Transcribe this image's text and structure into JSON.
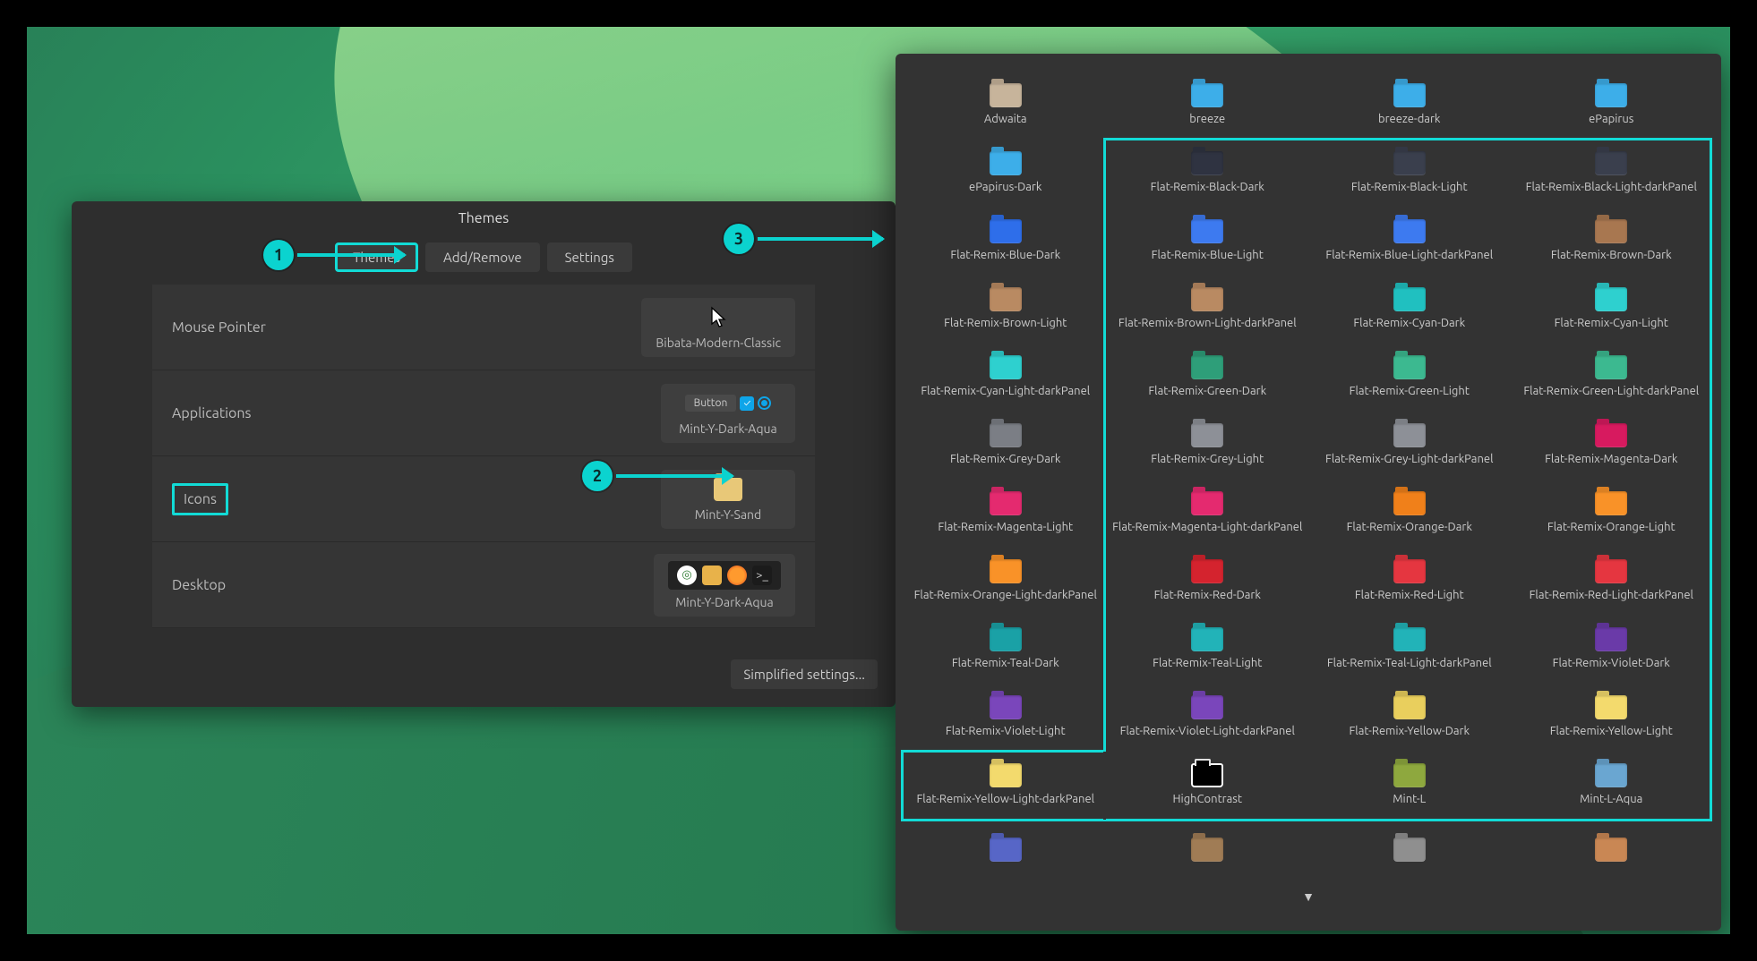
{
  "annotations": {
    "m1": "1",
    "m2": "2",
    "m3": "3"
  },
  "themes": {
    "title": "Themes",
    "tabs": {
      "themes": "Themes",
      "addremove": "Add/Remove",
      "settings": "Settings"
    },
    "rows": {
      "mouse": {
        "label": "Mouse Pointer",
        "value": "Bibata-Modern-Classic"
      },
      "apps": {
        "label": "Applications",
        "value": "Mint-Y-Dark-Aqua",
        "btn": "Button"
      },
      "icons": {
        "label": "Icons",
        "value": "Mint-Y-Sand"
      },
      "desktop": {
        "label": "Desktop",
        "value": "Mint-Y-Dark-Aqua"
      }
    },
    "simplified": "Simplified settings..."
  },
  "picker": {
    "items": [
      {
        "name": "Adwaita",
        "color": "#c7b49b"
      },
      {
        "name": "breeze",
        "color": "#3daee9"
      },
      {
        "name": "breeze-dark",
        "color": "#3daee9"
      },
      {
        "name": "ePapirus",
        "color": "#3daee9"
      },
      {
        "name": "ePapirus-Dark",
        "color": "#3daee9"
      },
      {
        "name": "Flat-Remix-Black-Dark",
        "color": "#2f3341"
      },
      {
        "name": "Flat-Remix-Black-Light",
        "color": "#3a3f4d"
      },
      {
        "name": "Flat-Remix-Black-Light-darkPanel",
        "color": "#3a3f4d"
      },
      {
        "name": "Flat-Remix-Blue-Dark",
        "color": "#2e6eea"
      },
      {
        "name": "Flat-Remix-Blue-Light",
        "color": "#3d7af0"
      },
      {
        "name": "Flat-Remix-Blue-Light-darkPanel",
        "color": "#3d7af0"
      },
      {
        "name": "Flat-Remix-Brown-Dark",
        "color": "#a87750"
      },
      {
        "name": "Flat-Remix-Brown-Light",
        "color": "#b98a62"
      },
      {
        "name": "Flat-Remix-Brown-Light-darkPanel",
        "color": "#b98a62"
      },
      {
        "name": "Flat-Remix-Cyan-Dark",
        "color": "#20c0c0"
      },
      {
        "name": "Flat-Remix-Cyan-Light",
        "color": "#2ed0cf"
      },
      {
        "name": "Flat-Remix-Cyan-Light-darkPanel",
        "color": "#2ed0cf"
      },
      {
        "name": "Flat-Remix-Green-Dark",
        "color": "#2e9e79"
      },
      {
        "name": "Flat-Remix-Green-Light",
        "color": "#3cb990"
      },
      {
        "name": "Flat-Remix-Green-Light-darkPanel",
        "color": "#3cb990"
      },
      {
        "name": "Flat-Remix-Grey-Dark",
        "color": "#7b7e85"
      },
      {
        "name": "Flat-Remix-Grey-Light",
        "color": "#8d9097"
      },
      {
        "name": "Flat-Remix-Grey-Light-darkPanel",
        "color": "#8d9097"
      },
      {
        "name": "Flat-Remix-Magenta-Dark",
        "color": "#d71a5f"
      },
      {
        "name": "Flat-Remix-Magenta-Light",
        "color": "#e42a6f"
      },
      {
        "name": "Flat-Remix-Magenta-Light-darkPanel",
        "color": "#e42a6f"
      },
      {
        "name": "Flat-Remix-Orange-Dark",
        "color": "#f0801a"
      },
      {
        "name": "Flat-Remix-Orange-Light",
        "color": "#f99228"
      },
      {
        "name": "Flat-Remix-Orange-Light-darkPanel",
        "color": "#f99228"
      },
      {
        "name": "Flat-Remix-Red-Dark",
        "color": "#d4232e"
      },
      {
        "name": "Flat-Remix-Red-Light",
        "color": "#e53640"
      },
      {
        "name": "Flat-Remix-Red-Light-darkPanel",
        "color": "#e53640"
      },
      {
        "name": "Flat-Remix-Teal-Dark",
        "color": "#1aa1a6"
      },
      {
        "name": "Flat-Remix-Teal-Light",
        "color": "#22b3b8"
      },
      {
        "name": "Flat-Remix-Teal-Light-darkPanel",
        "color": "#22b3b8"
      },
      {
        "name": "Flat-Remix-Violet-Dark",
        "color": "#6a3aa8"
      },
      {
        "name": "Flat-Remix-Violet-Light",
        "color": "#7a46bb"
      },
      {
        "name": "Flat-Remix-Violet-Light-darkPanel",
        "color": "#7a46bb"
      },
      {
        "name": "Flat-Remix-Yellow-Dark",
        "color": "#e9cf5d"
      },
      {
        "name": "Flat-Remix-Yellow-Light",
        "color": "#f3da6d"
      },
      {
        "name": "Flat-Remix-Yellow-Light-darkPanel",
        "color": "#f3da6d"
      },
      {
        "name": "HighContrast",
        "color": "outline"
      },
      {
        "name": "Mint-L",
        "color": "#8ea83e"
      },
      {
        "name": "Mint-L-Aqua",
        "color": "#6aa6d1"
      },
      {
        "name": "",
        "color": "#5766c7"
      },
      {
        "name": "",
        "color": "#a07c55"
      },
      {
        "name": "",
        "color": "#8f8f8f"
      },
      {
        "name": "",
        "color": "#c98754"
      }
    ]
  }
}
